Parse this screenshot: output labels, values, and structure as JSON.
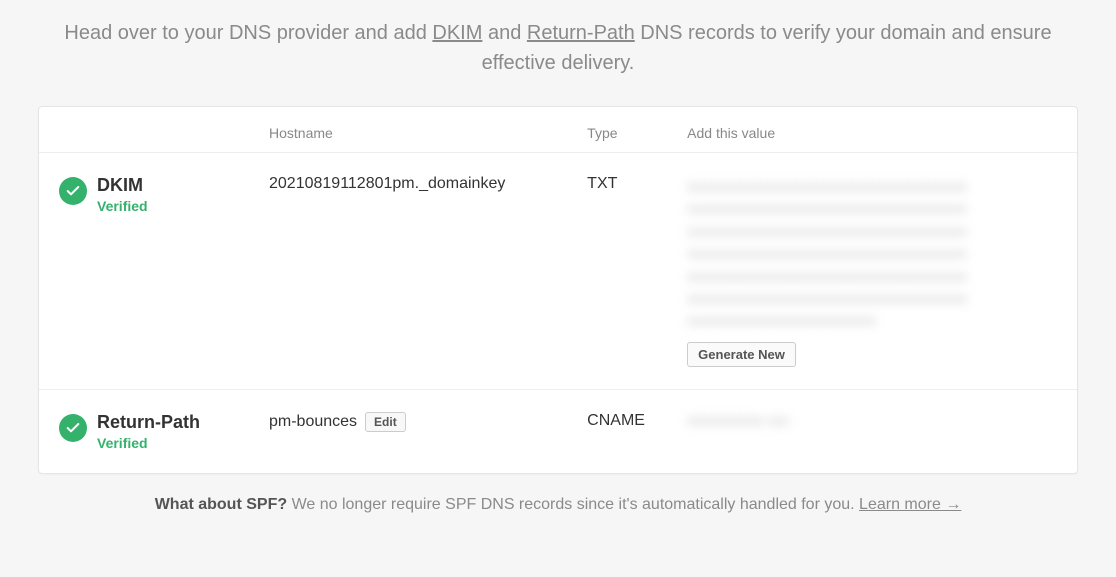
{
  "intro": {
    "prefix": "Head over to your DNS provider and add ",
    "link1": "DKIM",
    "mid1": " and ",
    "link2": "Return-Path",
    "suffix": " DNS records to verify your domain and ensure effective delivery."
  },
  "headers": {
    "hostname": "Hostname",
    "type": "Type",
    "value": "Add this value"
  },
  "rows": [
    {
      "title": "DKIM",
      "status": "Verified",
      "hostname": "20210819112801pm._domainkey",
      "type": "TXT",
      "value_placeholder": "xxxxxxxxxxxxxxxxxxxxxxxxxxxxxxxxxxxxxxxx xxxxxxxxxxxxxxxxxxxxxxxxxxxxxxxxxxxxxxxx xxxxxxxxxxxxxxxxxxxxxxxxxxxxxxxxxxxxxxxx xxxxxxxxxxxxxxxxxxxxxxxxxxxxxxxxxxxxxxxx xxxxxxxxxxxxxxxxxxxxxxxxxxxxxxxxxxxxxxxx xxxxxxxxxxxxxxxxxxxxxxxxxxxxxxxxxxxxxxxx xxxxxxxxxxxxxxxxxxxxxxxxxxx",
      "button": "Generate New"
    },
    {
      "title": "Return-Path",
      "status": "Verified",
      "hostname": "pm-bounces",
      "edit_label": "Edit",
      "type": "CNAME",
      "value_placeholder": "xxxxxxxxxxx xxx"
    }
  ],
  "footnote": {
    "bold": "What about SPF?",
    "text": " We no longer require SPF DNS records since it's automatically handled for you. ",
    "link": "Learn more →"
  }
}
